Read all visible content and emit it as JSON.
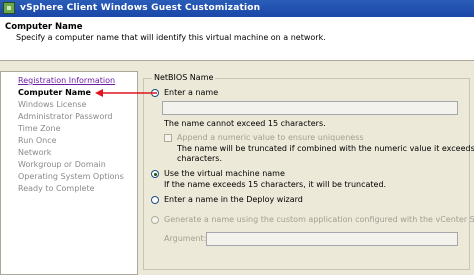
{
  "window": {
    "title": "vSphere Client Windows Guest Customization"
  },
  "header": {
    "title": "Computer Name",
    "description": "Specify a computer name that will identify this virtual machine on a network."
  },
  "nav": {
    "items": [
      {
        "label": "Registration Information"
      },
      {
        "label": "Computer Name"
      },
      {
        "label": "Windows License"
      },
      {
        "label": "Administrator Password"
      },
      {
        "label": "Time Zone"
      },
      {
        "label": "Run Once"
      },
      {
        "label": "Network"
      },
      {
        "label": "Workgroup or Domain"
      },
      {
        "label": "Operating System Options"
      },
      {
        "label": "Ready to Complete"
      }
    ]
  },
  "netbios": {
    "legend": "NetBIOS Name",
    "enter_name_label": "Enter a name",
    "name_value": "",
    "limit_note": "The name cannot exceed 15 characters.",
    "append_numeric_label": "Append a numeric value to ensure uniqueness",
    "truncate_note_line1": "The name will be truncated if combined with the numeric value it exceeds 15",
    "truncate_note_line2": "characters.",
    "use_vm_name_label": "Use the virtual machine name",
    "use_vm_name_note": "If the name exceeds 15 characters, it will be truncated.",
    "deploy_wizard_label": "Enter a name in the Deploy wizard",
    "generate_label": "Generate a name using the custom application configured with the vCenter Server",
    "argument_label": "Argument:",
    "argument_value": ""
  },
  "colors": {
    "annotation_arrow": "#e0141e",
    "title_bar": "#2a5db8",
    "link": "#6a1fa3"
  }
}
